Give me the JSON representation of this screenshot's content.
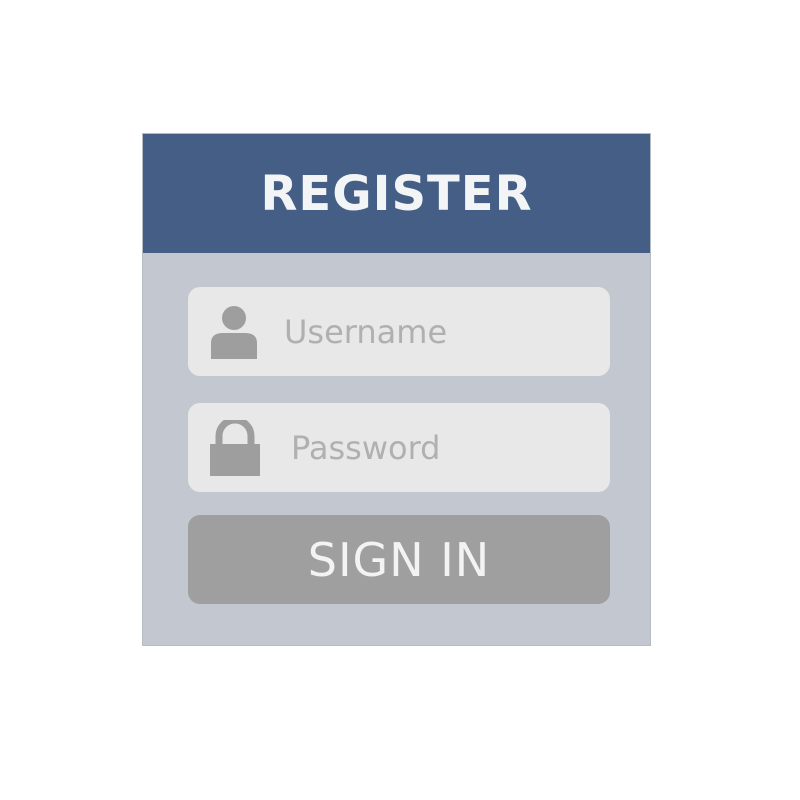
{
  "header": {
    "title": "REGISTER"
  },
  "form": {
    "username": {
      "placeholder": "Username",
      "value": "",
      "icon": "user-icon"
    },
    "password": {
      "placeholder": "Password",
      "value": "",
      "icon": "lock-icon"
    },
    "submit_label": "SIGN IN"
  },
  "colors": {
    "header_bg": "#445e86",
    "card_bg": "#c3c7d0",
    "field_bg": "#e8e8e8",
    "button_bg": "#9f9f9f",
    "icon": "#9e9e9e",
    "placeholder": "#b0b0b0",
    "header_text": "#f3f4f6",
    "button_text": "#f3f3f3"
  }
}
